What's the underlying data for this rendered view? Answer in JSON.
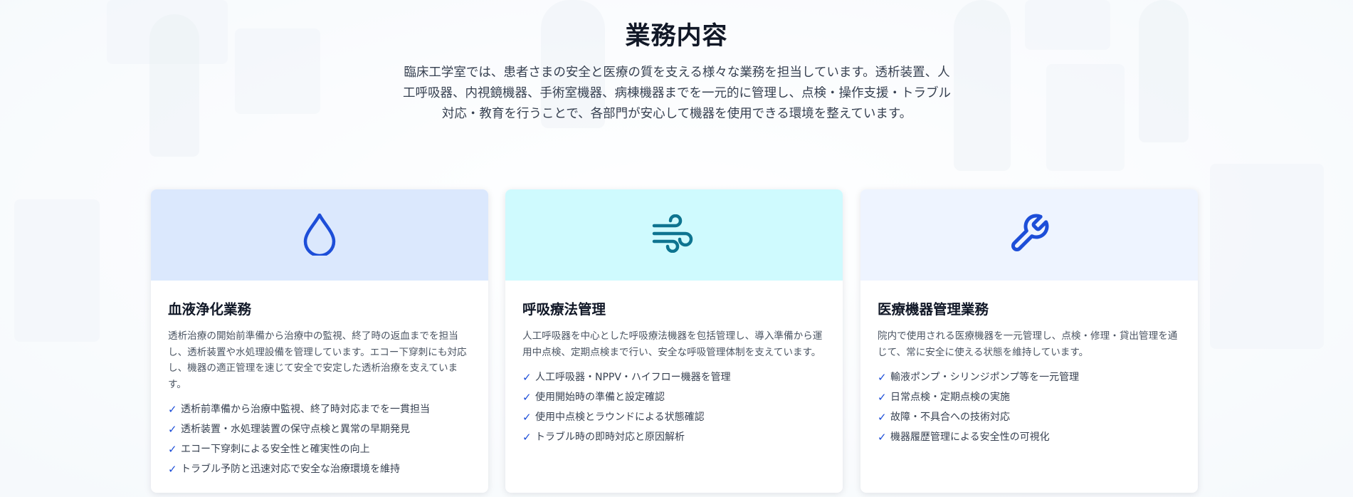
{
  "section": {
    "title": "業務内容",
    "intro": "臨床工学室では、患者さまの安全と医療の質を支える様々な業務を担当しています。透析装置、人工呼吸器、内視鏡機器、手術室機器、病棟機器までを一元的に管理し、点検・操作支援・トラブル対応・教育を行うことで、各部門が安心して機器を使用できる環境を整えています。"
  },
  "cards": [
    {
      "icon": "droplet-icon",
      "header_color": "#dbe8fd",
      "icon_color": "#1d4ed8",
      "title": "血液浄化業務",
      "description": "透析治療の開始前準備から治療中の監視、終了時の返血までを担当し、透析装置や水処理設備を管理しています。エコー下穿刺にも対応し、機器の適正管理を速じて安全で安定した透析治療を支えています。",
      "items": [
        "透析前準備から治療中監視、終了時対応までを一貫担当",
        "透析装置・水処理装置の保守点検と異常の早期発見",
        "エコー下穿刺による安全性と確実性の向上",
        "トラブル予防と迅速対応で安全な治療環境を維持"
      ]
    },
    {
      "icon": "wind-icon",
      "header_color": "#cffafe",
      "icon_color": "#0e7490",
      "title": "呼吸療法管理",
      "description": "人工呼吸器を中心とした呼吸療法機器を包括管理し、導入準備から運用中点検、定期点検まで行い、安全な呼吸管理体制を支えています。",
      "items": [
        "人工呼吸器・NPPV・ハイフロー機器を管理",
        "使用開始時の準備と設定確認",
        "使用中点検とラウンドによる状態確認",
        "トラブル時の即時対応と原因解析"
      ]
    },
    {
      "icon": "wrench-icon",
      "header_color": "#eef4ff",
      "icon_color": "#1d4ed8",
      "title": "医療機器管理業務",
      "description": "院内で使用される医療機器を一元管理し、点検・修理・貸出管理を通じて、常に安全に使える状態を維持しています。",
      "items": [
        "輸液ポンプ・シリンジポンプ等を一元管理",
        "日常点検・定期点検の実施",
        "故障・不具合への技術対応",
        "機器履歴管理による安全性の可視化"
      ]
    }
  ],
  "check_mark": "✓"
}
